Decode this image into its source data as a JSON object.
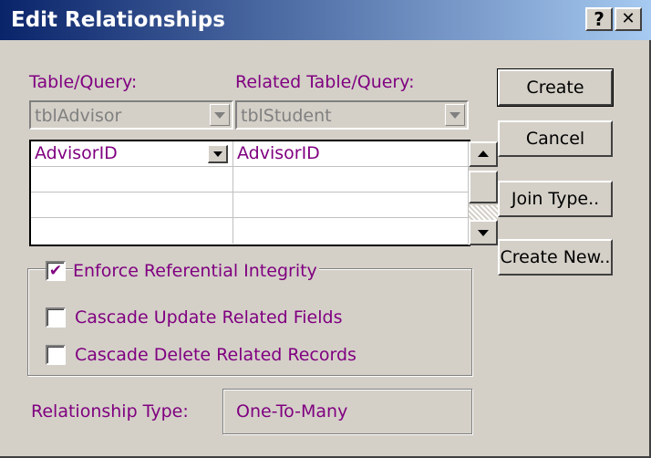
{
  "window": {
    "title": "Edit Relationships",
    "help_label": "?",
    "close_label": "✕"
  },
  "table_query": {
    "label": "Table/Query:",
    "value": "tblAdvisor"
  },
  "related_table_query": {
    "label": "Related Table/Query:",
    "value": "tblStudent"
  },
  "field_grid": {
    "rows": [
      {
        "left": "AdvisorID",
        "right": "AdvisorID"
      },
      {
        "left": "",
        "right": ""
      },
      {
        "left": "",
        "right": ""
      },
      {
        "left": "",
        "right": ""
      }
    ]
  },
  "options": {
    "enforce": {
      "label": "Enforce Referential Integrity",
      "checked": true,
      "mark": "✔"
    },
    "cascade_update": {
      "label": "Cascade Update Related Fields",
      "checked": false,
      "mark": ""
    },
    "cascade_delete": {
      "label": "Cascade Delete Related Records",
      "checked": false,
      "mark": ""
    }
  },
  "relationship": {
    "label": "Relationship Type:",
    "value": "One-To-Many"
  },
  "buttons": {
    "create": "Create",
    "cancel": "Cancel",
    "join_type": "Join Type..",
    "create_new": "Create New.."
  },
  "colors": {
    "title_start": "#0a246a",
    "title_end": "#a6caf0",
    "label_text": "#800080",
    "face": "#d4d0c8"
  }
}
